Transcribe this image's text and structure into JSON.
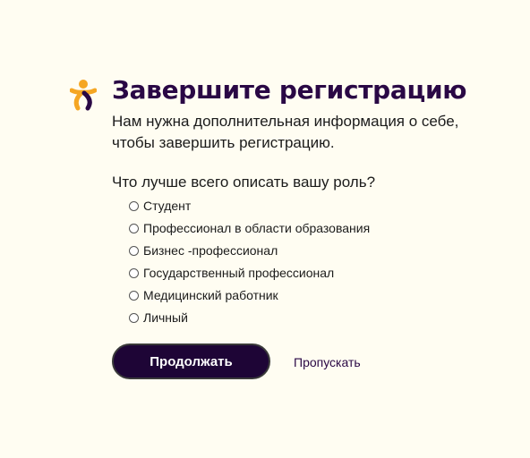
{
  "brand": {
    "logo_icon": "person-logo-icon",
    "colors": {
      "accent": "#f5a623",
      "primary": "#2a0845",
      "button_bg": "#1e0536",
      "page_bg": "#fffdf2"
    }
  },
  "header": {
    "title": "Завершите регистрацию",
    "subtitle": "Нам нужна дополнительная информация о себе, чтобы завершить регистрацию."
  },
  "form": {
    "question": "Что лучше всего описать вашу роль?",
    "options": [
      {
        "label": "Студент",
        "selected": false
      },
      {
        "label": "Профессионал в области образования",
        "selected": false
      },
      {
        "label": "Бизнес -профессионал",
        "selected": false
      },
      {
        "label": "Государственный профессионал",
        "selected": false
      },
      {
        "label": "Медицинский работник",
        "selected": false
      },
      {
        "label": "Личный",
        "selected": false
      }
    ]
  },
  "actions": {
    "continue_label": "Продолжать",
    "skip_label": "Пропускать"
  }
}
